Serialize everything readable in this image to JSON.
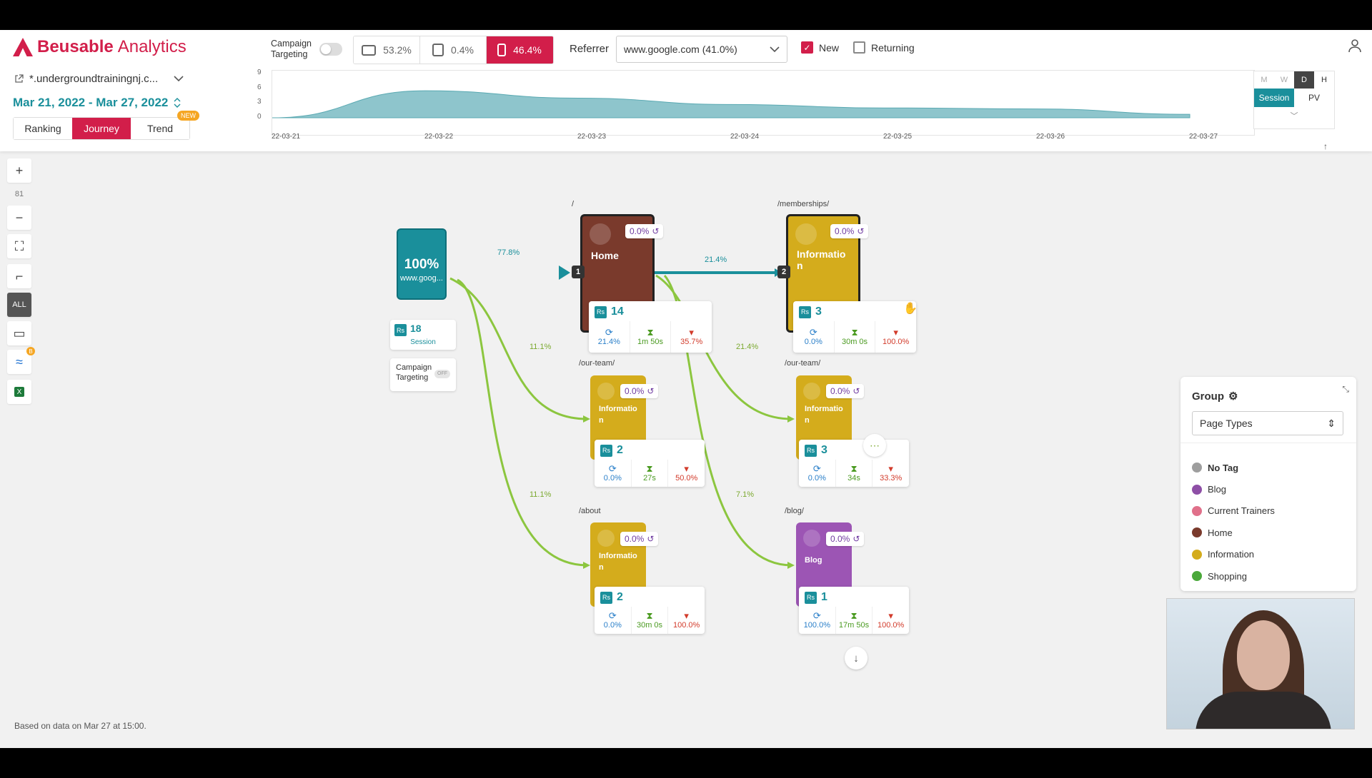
{
  "app": {
    "brand": "Beusable",
    "brand_suffix": "Analytics"
  },
  "site": {
    "name": "*.undergroundtrainingnj.c..."
  },
  "date_range": "Mar 21, 2022 - Mar 27, 2022",
  "mode_tabs": [
    {
      "label": "Ranking",
      "active": false
    },
    {
      "label": "Journey",
      "active": true
    },
    {
      "label": "Trend",
      "active": false,
      "badge": "NEW"
    }
  ],
  "campaign": {
    "label_line1": "Campaign",
    "label_line2": "Targeting"
  },
  "devices": [
    {
      "name": "desktop-icon",
      "value": "53.2%",
      "active": false
    },
    {
      "name": "tablet-icon",
      "value": "0.4%",
      "active": false
    },
    {
      "name": "mobile-icon",
      "value": "46.4%",
      "active": true
    }
  ],
  "referrer": {
    "label": "Referrer",
    "value": "www.google.com (41.0%)"
  },
  "visitor_filters": [
    {
      "label": "New",
      "checked": true
    },
    {
      "label": "Returning",
      "checked": false
    }
  ],
  "chart_data": {
    "type": "area",
    "x": [
      "22-03-21",
      "22-03-22",
      "22-03-23",
      "22-03-24",
      "22-03-25",
      "22-03-26",
      "22-03-27"
    ],
    "values": [
      0,
      5.5,
      4,
      2.7,
      2,
      1.8,
      0.7
    ],
    "ylim": [
      0,
      9
    ],
    "yticks": [
      "9",
      "6",
      "3",
      "0"
    ],
    "color": "#8ec5cc"
  },
  "granularity": {
    "options": [
      "M",
      "W",
      "D",
      "H"
    ],
    "active": "D",
    "metrics": [
      "Session",
      "PV"
    ],
    "active_metric": "Session"
  },
  "toolbar": {
    "zoom_level": "81",
    "all_label": "ALL",
    "badge": "B"
  },
  "source_node": {
    "percent": "100%",
    "name": "www.goog...",
    "count": "18",
    "count_label": "Session",
    "campaign_line1": "Campaign",
    "campaign_line2": "Targeting",
    "campaign_state": "OFF"
  },
  "flow_percents": {
    "src_home": "77.8%",
    "home_memberships": "21.4%",
    "src_ourteam": "11.1%",
    "src_about": "11.1%",
    "home_ourteam2": "21.4%",
    "home_blog": "7.1%"
  },
  "nodes": {
    "home": {
      "path": "/",
      "title": "Home",
      "step": "1",
      "return": "0.0%",
      "count": "14",
      "reentry": "21.4%",
      "duration": "1m 50s",
      "exit": "35.7%"
    },
    "memberships": {
      "path": "/memberships/",
      "title_line1": "Informatio",
      "title_line2": "n",
      "step": "2",
      "return": "0.0%",
      "count": "3",
      "reentry": "0.0%",
      "duration": "30m 0s",
      "exit": "100.0%"
    },
    "ourteam1": {
      "path": "/our-team/",
      "title_line1": "Informatio",
      "title_line2": "n",
      "return": "0.0%",
      "count": "2",
      "reentry": "0.0%",
      "duration": "27s",
      "exit": "50.0%"
    },
    "ourteam2": {
      "path": "/our-team/",
      "title_line1": "Informatio",
      "title_line2": "n",
      "return": "0.0%",
      "count": "3",
      "reentry": "0.0%",
      "duration": "34s",
      "exit": "33.3%"
    },
    "about": {
      "path": "/about",
      "title_line1": "Informatio",
      "title_line2": "n",
      "return": "0.0%",
      "count": "2",
      "reentry": "0.0%",
      "duration": "30m 0s",
      "exit": "100.0%"
    },
    "blog": {
      "path": "/blog/",
      "title": "Blog",
      "return": "0.0%",
      "count": "1",
      "reentry": "100.0%",
      "duration": "17m 50s",
      "exit": "100.0%"
    }
  },
  "group_panel": {
    "title": "Group",
    "select_value": "Page Types",
    "items": [
      {
        "label": "No Tag",
        "color": "#9e9e9e"
      },
      {
        "label": "Blog",
        "color": "#8e4fa6"
      },
      {
        "label": "Current Trainers",
        "color": "#e0708a"
      },
      {
        "label": "Home",
        "color": "#7a3a2c"
      },
      {
        "label": "Information",
        "color": "#d4ac1c"
      },
      {
        "label": "Shopping",
        "color": "#4aa83a"
      }
    ]
  },
  "footnote": "Based on data on Mar 27 at 15:00."
}
